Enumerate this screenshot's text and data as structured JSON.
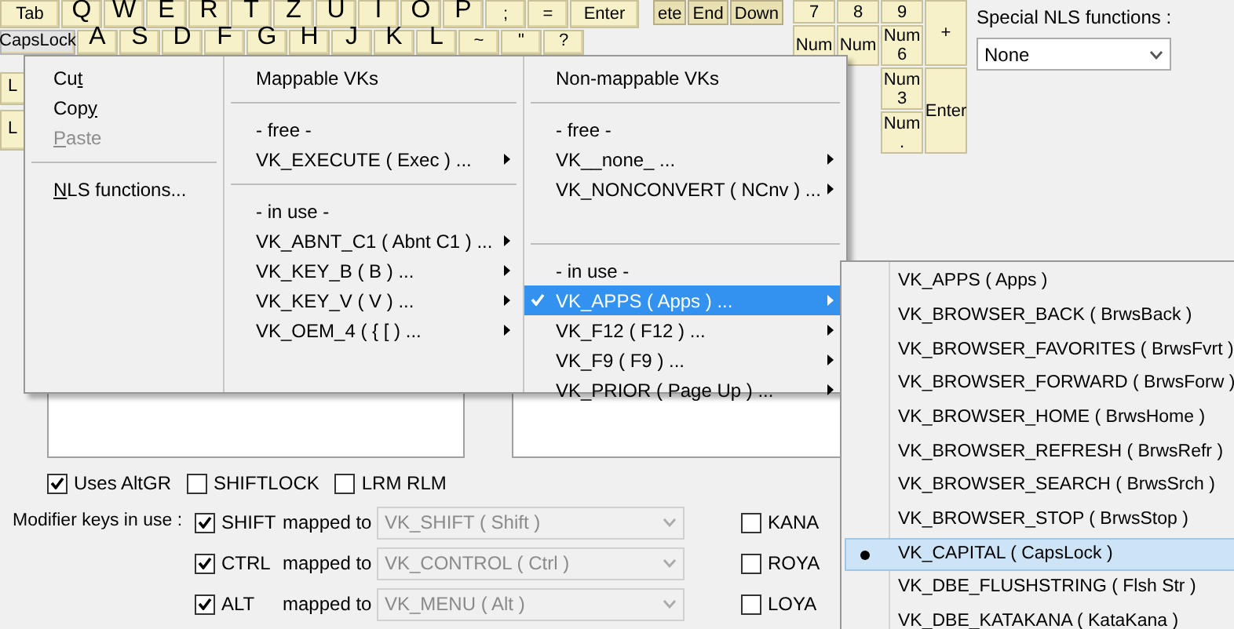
{
  "keyboard": {
    "rows": [
      {
        "keys": [
          {
            "label": "Tab",
            "kind": "word",
            "selected": false
          },
          {
            "label": "Q",
            "kind": "letter",
            "selected": false
          },
          {
            "label": "W",
            "kind": "letter",
            "selected": false
          },
          {
            "label": "E",
            "kind": "letter",
            "selected": false
          },
          {
            "label": "R",
            "kind": "letter",
            "selected": false
          },
          {
            "label": "T",
            "kind": "letter",
            "selected": false
          },
          {
            "label": "Z",
            "kind": "letter",
            "selected": false
          },
          {
            "label": "U",
            "kind": "letter",
            "selected": false
          },
          {
            "label": "I",
            "kind": "letter",
            "selected": false
          },
          {
            "label": "O",
            "kind": "letter",
            "selected": false
          },
          {
            "label": "P",
            "kind": "letter",
            "selected": false
          },
          {
            "label": ";",
            "kind": "symbol",
            "selected": false
          },
          {
            "label": "=",
            "kind": "symbol",
            "selected": false
          },
          {
            "label": "Enter",
            "kind": "word",
            "selected": false
          }
        ]
      },
      {
        "keys": [
          {
            "label": "CapsLock",
            "kind": "word",
            "selected": true
          },
          {
            "label": "A",
            "kind": "letter",
            "selected": false
          },
          {
            "label": "S",
            "kind": "letter",
            "selected": false
          },
          {
            "label": "D",
            "kind": "letter",
            "selected": false
          },
          {
            "label": "F",
            "kind": "letter",
            "selected": false
          },
          {
            "label": "G",
            "kind": "letter",
            "selected": false
          },
          {
            "label": "H",
            "kind": "letter",
            "selected": false
          },
          {
            "label": "J",
            "kind": "letter",
            "selected": false
          },
          {
            "label": "K",
            "kind": "letter",
            "selected": false
          },
          {
            "label": "L",
            "kind": "letter",
            "selected": false
          },
          {
            "label": "~",
            "kind": "symbol",
            "selected": false
          },
          {
            "label": "\"",
            "kind": "symbol",
            "selected": false
          },
          {
            "label": "?",
            "kind": "symbol",
            "selected": false
          }
        ]
      },
      {
        "keys": [
          {
            "label": "L",
            "kind": "word",
            "selected": false
          }
        ]
      },
      {
        "keys": [
          {
            "label": "L",
            "kind": "word",
            "selected": false
          }
        ]
      }
    ],
    "nav_keys": [
      {
        "label": "ete",
        "selected": false
      },
      {
        "label": "End",
        "selected": false
      },
      {
        "label": "Down",
        "selected": false
      }
    ],
    "numpad": [
      {
        "label": "7"
      },
      {
        "label": "8"
      },
      {
        "label": "9"
      },
      {
        "label": "+"
      },
      {
        "label": "Num"
      },
      {
        "label": "Num"
      },
      {
        "label": "Num 6"
      },
      {
        "label": "Num 3"
      },
      {
        "label": "Enter"
      },
      {
        "label": "Num ."
      }
    ]
  },
  "special_nls": {
    "label": "Special NLS functions :",
    "value": "None"
  },
  "options": [
    {
      "label": "Uses AltGR",
      "checked": true
    },
    {
      "label": "SHIFTLOCK",
      "checked": false
    },
    {
      "label": "LRM RLM",
      "checked": false
    }
  ],
  "modifiers": {
    "label": "Modifier keys in use :",
    "rows": [
      {
        "key": "SHIFT",
        "checked": true,
        "mapped_label": "mapped to",
        "mapping": "VK_SHIFT ( Shift )",
        "disabled": true,
        "extra": "KANA",
        "extra_checked": false
      },
      {
        "key": "CTRL",
        "checked": true,
        "mapped_label": "mapped to",
        "mapping": "VK_CONTROL ( Ctrl )",
        "disabled": true,
        "extra": "ROYA",
        "extra_checked": false
      },
      {
        "key": "ALT",
        "checked": true,
        "mapped_label": "mapped to",
        "mapping": "VK_MENU ( Alt )",
        "disabled": true,
        "extra": "LOYA",
        "extra_checked": false
      }
    ]
  },
  "context_menu": {
    "columns": [
      {
        "items": [
          {
            "kind": "item",
            "parts": [
              {
                "text": "Cu",
                "underlined": false
              },
              {
                "text": "t",
                "underlined": true
              }
            ],
            "disabled": false,
            "checked": false,
            "selected": false,
            "has_submenu": false
          },
          {
            "kind": "item",
            "parts": [
              {
                "text": "Cop",
                "underlined": false
              },
              {
                "text": "y",
                "underlined": true
              }
            ],
            "disabled": false,
            "checked": false,
            "selected": false,
            "has_submenu": false
          },
          {
            "kind": "item",
            "parts": [
              {
                "text": "P",
                "underlined": true
              },
              {
                "text": "aste",
                "underlined": false
              }
            ],
            "disabled": true,
            "checked": false,
            "selected": false,
            "has_submenu": false
          },
          {
            "kind": "separator"
          },
          {
            "kind": "item",
            "parts": [
              {
                "text": "N",
                "underlined": true
              },
              {
                "text": "LS functions...",
                "underlined": false
              }
            ],
            "disabled": false,
            "checked": false,
            "selected": false,
            "has_submenu": false
          }
        ]
      },
      {
        "items": [
          {
            "kind": "header",
            "label": "Mappable VKs"
          },
          {
            "kind": "separator"
          },
          {
            "kind": "label",
            "label": "- free -"
          },
          {
            "kind": "item",
            "label": "VK_EXECUTE ( Exec ) ...",
            "disabled": false,
            "checked": false,
            "selected": false,
            "has_submenu": true
          },
          {
            "kind": "separator"
          },
          {
            "kind": "label",
            "label": "- in use -"
          },
          {
            "kind": "item",
            "label": "VK_ABNT_C1 ( Abnt  C1 ) ...",
            "disabled": false,
            "checked": false,
            "selected": false,
            "has_submenu": true
          },
          {
            "kind": "item",
            "label": "VK_KEY_B ( B ) ...",
            "disabled": false,
            "checked": false,
            "selected": false,
            "has_submenu": true
          },
          {
            "kind": "item",
            "label": "VK_KEY_V ( V ) ...",
            "disabled": false,
            "checked": false,
            "selected": false,
            "has_submenu": true
          },
          {
            "kind": "item",
            "label": "VK_OEM_4 ( {   [   ) ...",
            "disabled": false,
            "checked": false,
            "selected": false,
            "has_submenu": true
          }
        ]
      },
      {
        "items": [
          {
            "kind": "header",
            "label": "Non-mappable VKs"
          },
          {
            "kind": "separator"
          },
          {
            "kind": "label",
            "label": "- free -"
          },
          {
            "kind": "item",
            "label": "VK__none_ ...",
            "disabled": false,
            "checked": false,
            "selected": false,
            "has_submenu": true
          },
          {
            "kind": "item",
            "label": "VK_NONCONVERT ( NCnv ) ...",
            "disabled": false,
            "checked": false,
            "selected": false,
            "has_submenu": true
          },
          {
            "kind": "spacer"
          },
          {
            "kind": "separator"
          },
          {
            "kind": "label",
            "label": "- in use -"
          },
          {
            "kind": "item",
            "label": "VK_APPS ( Apps ) ...",
            "disabled": false,
            "checked": true,
            "selected": true,
            "has_submenu": true
          },
          {
            "kind": "item",
            "label": "VK_F12 ( F12 ) ...",
            "disabled": false,
            "checked": false,
            "selected": false,
            "has_submenu": true
          },
          {
            "kind": "item",
            "label": "VK_F9 ( F9 ) ...",
            "disabled": false,
            "checked": false,
            "selected": false,
            "has_submenu": true
          },
          {
            "kind": "item",
            "label": "VK_PRIOR ( Page Up ) ...",
            "disabled": false,
            "checked": false,
            "selected": false,
            "has_submenu": true
          }
        ]
      }
    ]
  },
  "submenu": {
    "items": [
      {
        "label": "VK_APPS ( Apps )",
        "checked": false,
        "selected": false
      },
      {
        "label": "VK_BROWSER_BACK ( BrwsBack )",
        "checked": false,
        "selected": false
      },
      {
        "label": "VK_BROWSER_FAVORITES ( BrwsFvrt )",
        "checked": false,
        "selected": false
      },
      {
        "label": "VK_BROWSER_FORWARD ( BrwsForw )",
        "checked": false,
        "selected": false
      },
      {
        "label": "VK_BROWSER_HOME ( BrwsHome )",
        "checked": false,
        "selected": false
      },
      {
        "label": "VK_BROWSER_REFRESH ( BrwsRefr )",
        "checked": false,
        "selected": false
      },
      {
        "label": "VK_BROWSER_SEARCH ( BrwsSrch )",
        "checked": false,
        "selected": false
      },
      {
        "label": "VK_BROWSER_STOP ( BrwsStop )",
        "checked": false,
        "selected": false
      },
      {
        "label": "VK_CAPITAL ( CapsLock )",
        "checked": true,
        "selected": true
      },
      {
        "label": "VK_DBE_FLUSHSTRING ( Flsh Str )",
        "checked": false,
        "selected": false
      },
      {
        "label": "VK_DBE_KATAKANA ( KataKana )",
        "checked": false,
        "selected": false
      }
    ]
  }
}
